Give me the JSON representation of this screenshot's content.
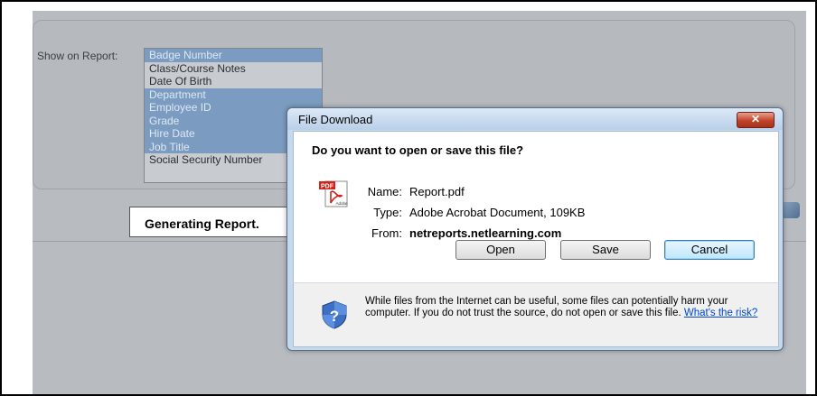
{
  "report": {
    "show_label": "Show on Report:",
    "items": [
      {
        "label": "Badge Number",
        "selected": true
      },
      {
        "label": "Class/Course Notes",
        "selected": false
      },
      {
        "label": "Date Of Birth",
        "selected": false
      },
      {
        "label": "Department",
        "selected": true
      },
      {
        "label": "Employee ID",
        "selected": true
      },
      {
        "label": "Grade",
        "selected": true
      },
      {
        "label": "Hire Date",
        "selected": true
      },
      {
        "label": "Job Title",
        "selected": true
      },
      {
        "label": "Social Security Number",
        "selected": false
      }
    ],
    "generating_text": "Generating Report."
  },
  "dialog": {
    "title": "File Download",
    "close_label": "✕",
    "question": "Do you want to open or save this file?",
    "name_key": "Name:",
    "name_value": "Report.pdf",
    "type_key": "Type:",
    "type_value": "Adobe Acrobat Document, 109KB",
    "from_key": "From:",
    "from_value": "netreports.netlearning.com",
    "open_label": "Open",
    "save_label": "Save",
    "cancel_label": "Cancel",
    "warning_text": "While files from the Internet can be useful, some files can potentially harm your computer. If you do not trust the source, do not open or save this file.",
    "risk_link": "What's the risk?",
    "pdf_badge": "PDF",
    "adobe_text": "Adobe"
  },
  "colors": {
    "selection": "#7b9cc0",
    "page_bg": "#b8bcc0",
    "dialog_frame": "#c6d8ec",
    "close_red": "#c0432a",
    "link": "#0046d5"
  }
}
